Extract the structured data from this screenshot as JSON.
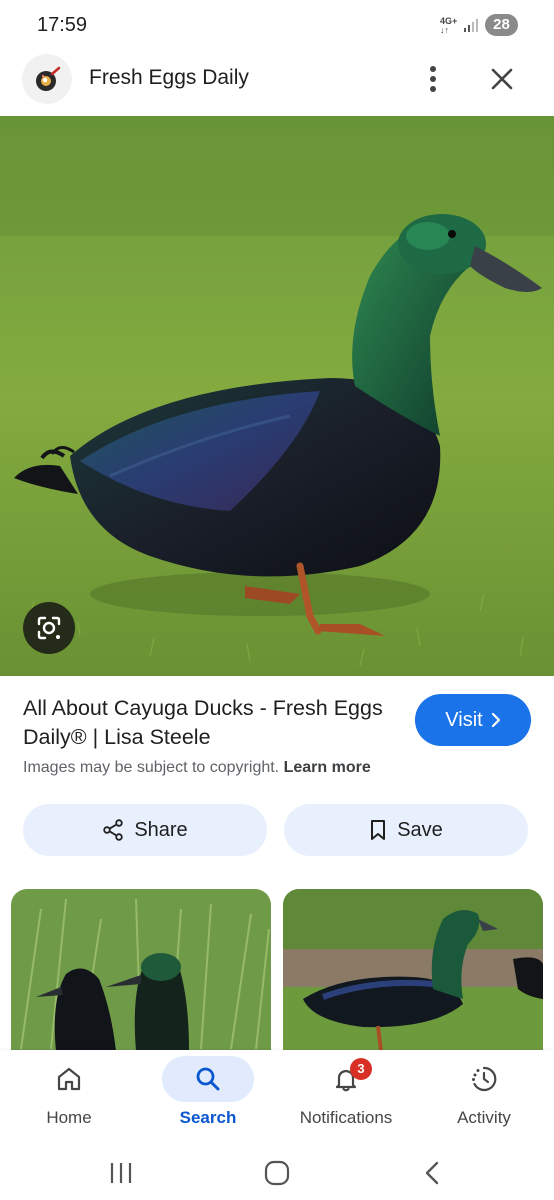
{
  "status_bar": {
    "time": "17:59",
    "network": "4G+",
    "battery": "28",
    "icons": [
      "network-type-icon",
      "signal-icon",
      "battery-icon"
    ]
  },
  "header": {
    "site_name": "Fresh Eggs Daily",
    "icons": [
      "site-logo-icon",
      "more-vert-icon",
      "close-icon"
    ]
  },
  "result": {
    "title": "All About Cayuga Ducks - Fresh Eggs Daily® | Lisa Steele",
    "visit_label": "Visit",
    "copyright_text": "Images may be subject to copyright.",
    "learn_more_label": "Learn more"
  },
  "actions": {
    "share_label": "Share",
    "save_label": "Save"
  },
  "bottom_nav": {
    "items": [
      {
        "label": "Home",
        "icon": "home-icon",
        "active": false
      },
      {
        "label": "Search",
        "icon": "search-icon",
        "active": true
      },
      {
        "label": "Notifications",
        "icon": "bell-icon",
        "active": false,
        "badge": "3"
      },
      {
        "label": "Activity",
        "icon": "activity-icon",
        "active": false
      }
    ]
  },
  "system_nav": {
    "icons": [
      "recent-apps-icon",
      "home-circle-icon",
      "back-icon"
    ]
  },
  "colors": {
    "accent": "#1a73e8",
    "chip_background": "#e8f0fe",
    "active_nav": "#0b57d0",
    "badge": "#d93025"
  }
}
